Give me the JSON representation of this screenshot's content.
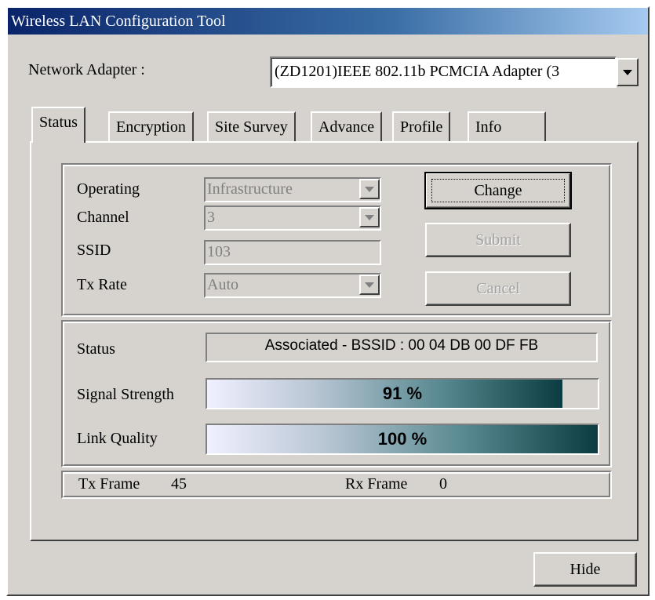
{
  "window": {
    "title": "Wireless LAN Configuration Tool"
  },
  "adapter": {
    "label": "Network Adapter :",
    "value": "(ZD1201)IEEE 802.11b PCMCIA Adapter (3"
  },
  "tabs": [
    {
      "label": "Status",
      "active": true
    },
    {
      "label": "Encryption"
    },
    {
      "label": "Site Survey"
    },
    {
      "label": "Advance"
    },
    {
      "label": "Profile"
    },
    {
      "label": "Info"
    }
  ],
  "config": {
    "operating_label": "Operating",
    "operating_value": "Infrastructure",
    "channel_label": "Channel",
    "channel_value": "3",
    "ssid_label": "SSID",
    "ssid_value": "103",
    "txrate_label": "Tx Rate",
    "txrate_value": "Auto",
    "change_label": "Change",
    "submit_label": "Submit",
    "cancel_label": "Cancel"
  },
  "status": {
    "status_label": "Status",
    "status_value": "Associated - BSSID : 00 04 DB 00 DF FB",
    "signal_label": "Signal Strength",
    "signal_text": "91 %",
    "signal_fraction": 0.91,
    "link_label": "Link Quality",
    "link_text": "100 %",
    "link_fraction": 1.0
  },
  "frames": {
    "tx_label": "Tx Frame",
    "tx_value": "45",
    "rx_label": "Rx Frame",
    "rx_value": "0"
  },
  "hide_label": "Hide"
}
